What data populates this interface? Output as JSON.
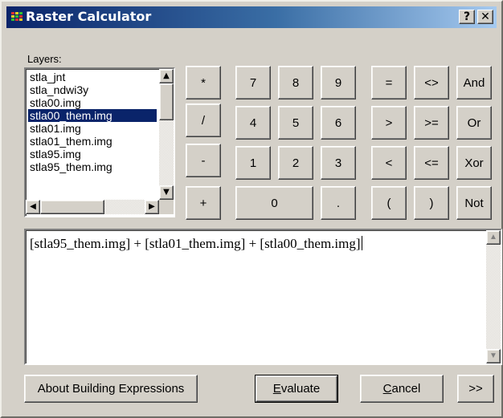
{
  "window": {
    "title": "Raster Calculator",
    "help": "?",
    "close": "✕"
  },
  "layers": {
    "label": "Layers:",
    "items": [
      "stla_jnt",
      "stla_ndwi3y",
      "stla00.img",
      "stla00_them.img",
      "stla01.img",
      "stla01_them.img",
      "stla95.img",
      "stla95_them.img"
    ],
    "selected_index": 3
  },
  "keypad": {
    "operators": [
      "*",
      "/",
      "-",
      "+"
    ],
    "digits_row1": [
      "7",
      "8",
      "9"
    ],
    "digits_row2": [
      "4",
      "5",
      "6"
    ],
    "digits_row3": [
      "1",
      "2",
      "3"
    ],
    "zero": "0",
    "dot": ".",
    "rel_row1": [
      "=",
      "<>",
      "And"
    ],
    "rel_row2": [
      ">",
      ">=",
      "Or"
    ],
    "rel_row3": [
      "<",
      "<=",
      "Xor"
    ],
    "rel_row4": [
      "(",
      ")",
      "Not"
    ]
  },
  "expression": {
    "value": "[stla95_them.img] + [stla01_them.img] + [stla00_them.img]"
  },
  "buttons": {
    "about": "About Building Expressions",
    "evaluate_hotkey": "E",
    "evaluate_rest": "valuate",
    "cancel_hotkey": "C",
    "cancel_rest": "ancel",
    "expand": ">>"
  },
  "colors": {
    "selection": "#0a246a",
    "title_start": "#0a246a",
    "title_end": "#a6caf0",
    "face": "#d4d0c8"
  }
}
